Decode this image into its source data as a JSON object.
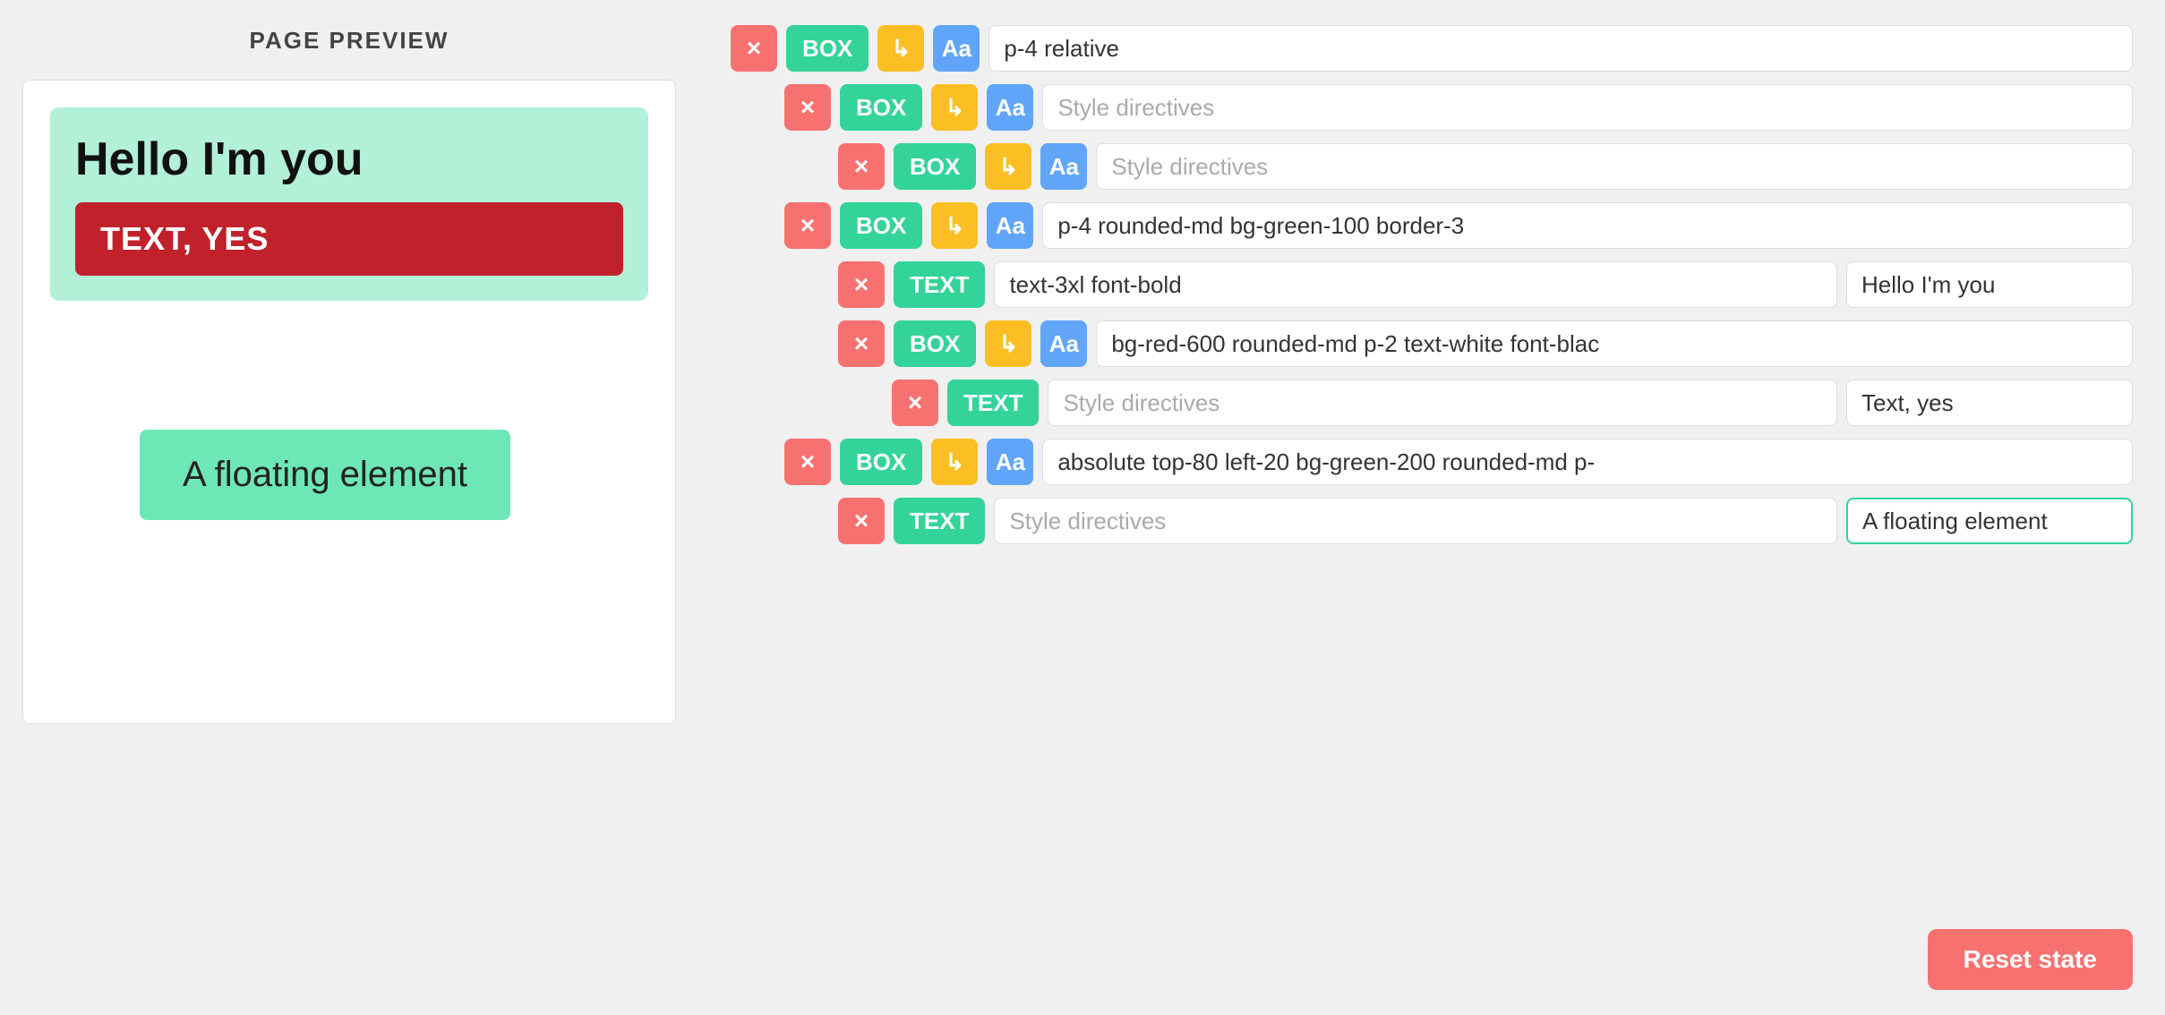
{
  "left": {
    "title": "PAGE PREVIEW",
    "hello_text": "Hello I'm you",
    "red_text": "TEXT, YES",
    "floating_text": "A floating element"
  },
  "right": {
    "rows": [
      {
        "id": "row1",
        "indent": 0,
        "x": "×",
        "type": "BOX",
        "has_arrow": true,
        "has_aa": true,
        "style_value": "p-4 relative",
        "text_value": null
      },
      {
        "id": "row2",
        "indent": 1,
        "x": "×",
        "type": "BOX",
        "has_arrow": true,
        "has_aa": true,
        "style_placeholder": "Style directives",
        "style_value": "",
        "text_value": null
      },
      {
        "id": "row3",
        "indent": 2,
        "x": "×",
        "type": "BOX",
        "has_arrow": true,
        "has_aa": true,
        "style_placeholder": "Style directives",
        "style_value": "",
        "text_value": null
      },
      {
        "id": "row4",
        "indent": 1,
        "x": "×",
        "type": "BOX",
        "has_arrow": true,
        "has_aa": true,
        "style_value": "p-4 rounded-md bg-green-100 border-3",
        "text_value": null
      },
      {
        "id": "row5",
        "indent": 2,
        "x": "×",
        "type": "TEXT",
        "has_arrow": false,
        "has_aa": false,
        "style_value": "text-3xl font-bold",
        "text_value": "Hello I'm you"
      },
      {
        "id": "row6",
        "indent": 2,
        "x": "×",
        "type": "BOX",
        "has_arrow": true,
        "has_aa": true,
        "style_value": "bg-red-600 rounded-md p-2 text-white font-blac",
        "text_value": null
      },
      {
        "id": "row7",
        "indent": 3,
        "x": "×",
        "type": "TEXT",
        "has_arrow": false,
        "has_aa": false,
        "style_placeholder": "Style directives",
        "style_value": "",
        "text_value": "Text, yes"
      },
      {
        "id": "row8",
        "indent": 1,
        "x": "×",
        "type": "BOX",
        "has_arrow": true,
        "has_aa": true,
        "style_value": "absolute top-80 left-20 bg-green-200 rounded-md p-",
        "text_value": null
      },
      {
        "id": "row9",
        "indent": 2,
        "x": "×",
        "type": "TEXT",
        "has_arrow": false,
        "has_aa": false,
        "style_placeholder": "Style directives",
        "style_value": "",
        "text_value": "A floating element"
      }
    ],
    "reset_label": "Reset state"
  },
  "icons": {
    "x": "×",
    "arrow": "↳",
    "aa": "Aa"
  }
}
